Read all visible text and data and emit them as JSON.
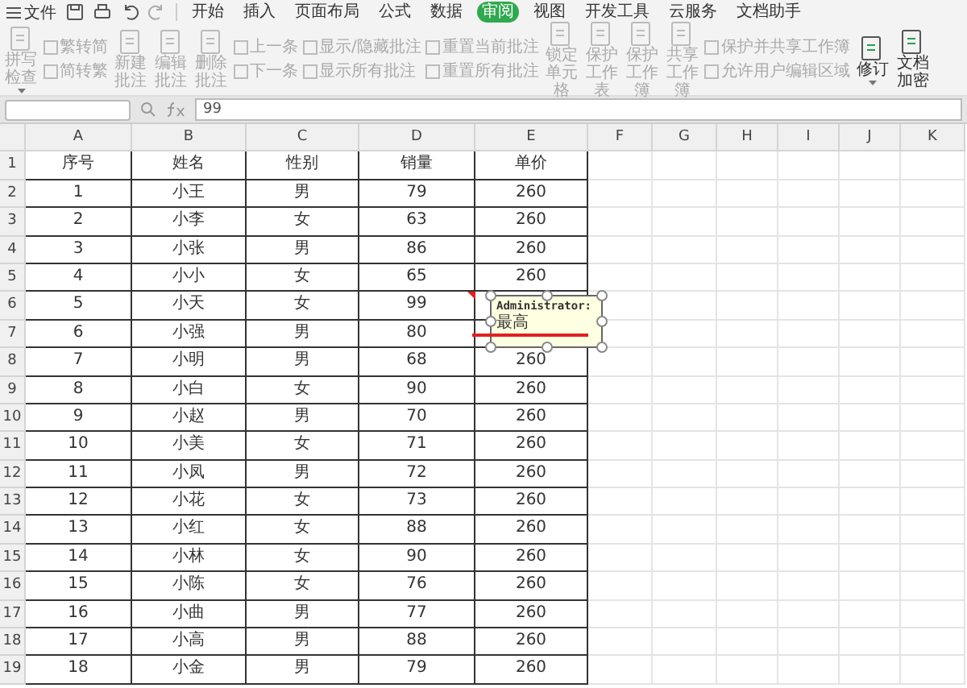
{
  "menu_bar": {
    "file_menu": "文件",
    "tabs": [
      {
        "label": "开始",
        "selected": false
      },
      {
        "label": "插入",
        "selected": false
      },
      {
        "label": "页面布局",
        "selected": false
      },
      {
        "label": "公式",
        "selected": false
      },
      {
        "label": "数据",
        "selected": false
      },
      {
        "label": "审阅",
        "selected": true
      },
      {
        "label": "视图",
        "selected": false
      },
      {
        "label": "开发工具",
        "selected": false
      },
      {
        "label": "云服务",
        "selected": false
      },
      {
        "label": "文档助手",
        "selected": false
      }
    ]
  },
  "ribbon": [
    {
      "kind": "big",
      "label": "拼写检查",
      "disabled": true,
      "dropdown": true
    },
    {
      "kind": "pair",
      "items": [
        {
          "label": "繁转简",
          "disabled": true
        },
        {
          "label": "简转繁",
          "disabled": true
        }
      ]
    },
    {
      "kind": "big",
      "label": "新建批注",
      "disabled": true,
      "dropdown": false
    },
    {
      "kind": "big",
      "label": "编辑批注",
      "disabled": true,
      "dropdown": false
    },
    {
      "kind": "big",
      "label": "删除批注",
      "disabled": true,
      "dropdown": false
    },
    {
      "kind": "pair",
      "items": [
        {
          "label": "上一条",
          "disabled": true
        },
        {
          "label": "下一条",
          "disabled": true
        }
      ]
    },
    {
      "kind": "pair",
      "items": [
        {
          "label": "显示/隐藏批注",
          "disabled": true
        },
        {
          "label": "显示所有批注",
          "disabled": true
        }
      ]
    },
    {
      "kind": "pair",
      "items": [
        {
          "label": "重置当前批注",
          "disabled": true
        },
        {
          "label": "重置所有批注",
          "disabled": true
        }
      ]
    },
    {
      "kind": "big",
      "label": "锁定单元格",
      "disabled": true,
      "dropdown": false
    },
    {
      "kind": "big",
      "label": "保护工作表",
      "disabled": true,
      "dropdown": false
    },
    {
      "kind": "big",
      "label": "保护工作簿",
      "disabled": true,
      "dropdown": false
    },
    {
      "kind": "big",
      "label": "共享工作簿",
      "disabled": true,
      "dropdown": false
    },
    {
      "kind": "pair",
      "items": [
        {
          "label": "保护并共享工作簿",
          "disabled": true
        },
        {
          "label": "允许用户编辑区域",
          "disabled": true
        }
      ]
    },
    {
      "kind": "big",
      "label": "修订",
      "disabled": false,
      "dropdown": true
    },
    {
      "kind": "big",
      "label": "文档加密",
      "disabled": false,
      "dropdown": false
    }
  ],
  "formula_bar": {
    "value": "99"
  },
  "sheet": {
    "columns": [
      "A",
      "B",
      "C",
      "D",
      "E",
      "F",
      "G",
      "H",
      "I",
      "J",
      "K"
    ],
    "rows": [
      {
        "number": "1",
        "cells": [
          "序号",
          "姓名",
          "性别",
          "销量",
          "单价"
        ]
      },
      {
        "number": "2",
        "cells": [
          "1",
          "小王",
          "男",
          "79",
          "260"
        ]
      },
      {
        "number": "3",
        "cells": [
          "2",
          "小李",
          "女",
          "63",
          "260"
        ]
      },
      {
        "number": "4",
        "cells": [
          "3",
          "小张",
          "男",
          "86",
          "260"
        ]
      },
      {
        "number": "5",
        "cells": [
          "4",
          "小小",
          "女",
          "65",
          "260"
        ]
      },
      {
        "number": "6",
        "cells": [
          "5",
          "小天",
          "女",
          "99",
          ""
        ]
      },
      {
        "number": "7",
        "cells": [
          "6",
          "小强",
          "男",
          "80",
          ""
        ]
      },
      {
        "number": "8",
        "cells": [
          "7",
          "小明",
          "男",
          "68",
          "260"
        ]
      },
      {
        "number": "9",
        "cells": [
          "8",
          "小白",
          "女",
          "90",
          "260"
        ]
      },
      {
        "number": "10",
        "cells": [
          "9",
          "小赵",
          "男",
          "70",
          "260"
        ]
      },
      {
        "number": "11",
        "cells": [
          "10",
          "小美",
          "女",
          "71",
          "260"
        ]
      },
      {
        "number": "12",
        "cells": [
          "11",
          "小凤",
          "男",
          "72",
          "260"
        ]
      },
      {
        "number": "13",
        "cells": [
          "12",
          "小花",
          "女",
          "73",
          "260"
        ]
      },
      {
        "number": "14",
        "cells": [
          "13",
          "小红",
          "女",
          "88",
          "260"
        ]
      },
      {
        "number": "15",
        "cells": [
          "14",
          "小林",
          "女",
          "90",
          "260"
        ]
      },
      {
        "number": "16",
        "cells": [
          "15",
          "小陈",
          "女",
          "76",
          "260"
        ]
      },
      {
        "number": "17",
        "cells": [
          "16",
          "小曲",
          "男",
          "77",
          "260"
        ]
      },
      {
        "number": "18",
        "cells": [
          "17",
          "小高",
          "男",
          "88",
          "260"
        ]
      },
      {
        "number": "19",
        "cells": [
          "18",
          "小金",
          "男",
          "79",
          "260"
        ]
      }
    ],
    "comment": {
      "author": "Administrator:",
      "text": "最高"
    }
  }
}
